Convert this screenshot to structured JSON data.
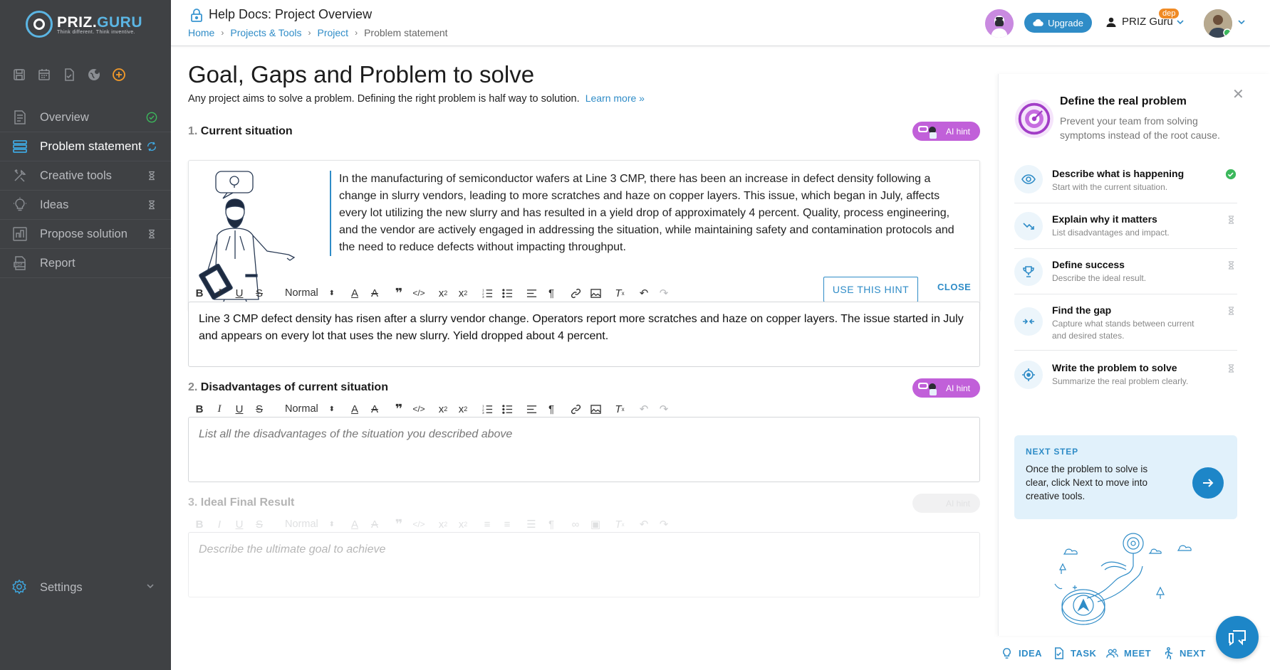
{
  "app": {
    "logo_main": "PRIZ.",
    "logo_accent": "GURU",
    "logo_tagline": "Think different. Think inventive."
  },
  "header": {
    "doc_title": "Help Docs: Project Overview",
    "breadcrumb": [
      "Home",
      "Projects & Tools",
      "Project"
    ],
    "breadcrumb_current": "Problem statement",
    "upgrade_label": "Upgrade",
    "user_name": "PRIZ Guru",
    "user_badge": "dep"
  },
  "sidebar": {
    "quick_icons": [
      "save-icon",
      "calendar-icon",
      "document-icon",
      "globe-icon",
      "add-icon"
    ],
    "items": [
      {
        "label": "Overview",
        "icon": "overview-icon",
        "status": "done"
      },
      {
        "label": "Problem statement",
        "icon": "problem-icon",
        "status": "in-progress"
      },
      {
        "label": "Creative tools",
        "icon": "tools-icon",
        "status": "pending"
      },
      {
        "label": "Ideas",
        "icon": "lightbulb-icon",
        "status": "pending"
      },
      {
        "label": "Propose solution",
        "icon": "propose-icon",
        "status": "pending"
      },
      {
        "label": "Report",
        "icon": "pdf-icon",
        "status": "none"
      }
    ],
    "settings_label": "Settings"
  },
  "main": {
    "title": "Goal, Gaps and Problem to solve",
    "subtitle": "Any project aims to solve a problem. Defining the right problem is half way to solution.",
    "learn_more": "Learn more »",
    "ai_hint_label": "AI hint",
    "sections": [
      {
        "num": "1.",
        "title": "Current situation",
        "value": "Line 3 CMP defect density has risen after a slurry vendor change. Operators report more scratches and haze on copper layers. The issue started in July and appears on every lot that uses the new slurry. Yield dropped about 4 percent.",
        "placeholder": ""
      },
      {
        "num": "2.",
        "title": "Disadvantages of current situation",
        "value": "",
        "placeholder": "List all the disadvantages of the situation you described above"
      },
      {
        "num": "3.",
        "title": "Ideal Final Result",
        "value": "",
        "placeholder": "Describe the ultimate goal to achieve"
      }
    ],
    "hint": {
      "text": "In the manufacturing of semiconductor wafers at Line 3 CMP, there has been an increase in defect density following a change in slurry vendors, leading to more scratches and haze on copper layers. This issue, which began in July, affects every lot utilizing the new slurry and has resulted in a yield drop of approximately 4 percent. Quality, process engineering, and the vendor are actively engaged in addressing the situation, while maintaining safety and contamination protocols and the need to reduce defects without impacting throughput.",
      "use_label": "USE THIS HINT",
      "close_label": "CLOSE"
    },
    "toolbar": {
      "format_value": "Normal"
    }
  },
  "panel": {
    "title": "Define the real problem",
    "desc": "Prevent your team from solving symptoms instead of the root cause.",
    "steps": [
      {
        "title": "Describe what is happening",
        "desc": "Start with the current situation.",
        "icon": "eye-icon",
        "status": "done"
      },
      {
        "title": "Explain why it matters",
        "desc": "List disadvantages and impact.",
        "icon": "trend-down-icon",
        "status": "pending"
      },
      {
        "title": "Define success",
        "desc": "Describe the ideal result.",
        "icon": "trophy-icon",
        "status": "pending"
      },
      {
        "title": "Find the gap",
        "desc": "Capture what stands between current and desired states.",
        "icon": "gap-icon",
        "status": "pending"
      },
      {
        "title": "Write the problem to solve",
        "desc": "Summarize the real problem clearly.",
        "icon": "target-icon",
        "status": "pending"
      }
    ],
    "next_label": "NEXT STEP",
    "next_text": "Once the problem to solve is clear, click Next to move into creative tools."
  },
  "bottombar": {
    "idea": "IDEA",
    "task": "TASK",
    "meet": "MEET",
    "next": "NEXT"
  },
  "colors": {
    "sidebar_bg": "#3f4144",
    "accent": "#2f8cc7",
    "ai_hint": "#c160d9",
    "done_green": "#3cb85c",
    "badge_orange": "#f08a24"
  }
}
